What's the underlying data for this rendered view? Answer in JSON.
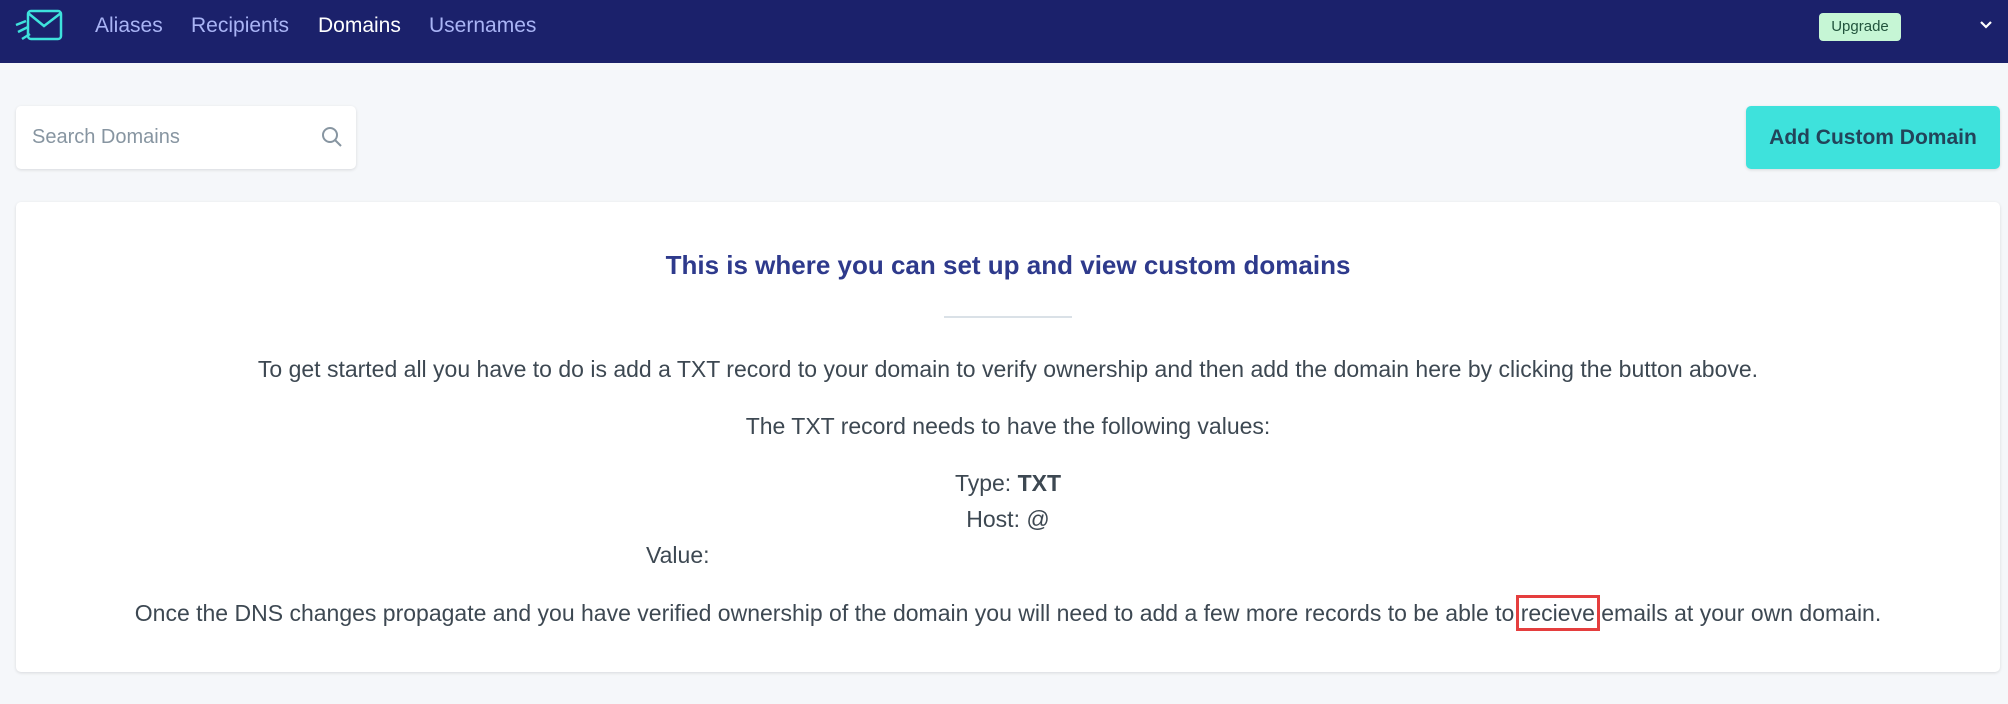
{
  "nav": {
    "links": [
      "Aliases",
      "Recipients",
      "Domains",
      "Usernames"
    ],
    "active": "Domains",
    "upgrade_label": "Upgrade",
    "logo_icon": "envelope-logo-icon",
    "menu_icon": "chevron-down-icon"
  },
  "search": {
    "placeholder": "Search Domains",
    "value": "",
    "icon": "search-icon"
  },
  "actions": {
    "add_label": "Add Custom Domain"
  },
  "info": {
    "title": "This is where you can set up and view custom domains",
    "intro": "To get started all you have to do is add a TXT record to your domain to verify ownership and then add the domain here by clicking the button above.",
    "record_intro": "The TXT record needs to have the following values:",
    "type_label": "Type:",
    "type_value": "TXT",
    "host_label": "Host:",
    "host_value": "@",
    "value_label": "Value:",
    "outro_before": "Once the DNS changes propagate and you have verified ownership of the domain you will need to add a few more records to be able to",
    "outro_highlight": "recieve",
    "outro_after": "emails at your own domain."
  },
  "colors": {
    "navbar": "#1b216b",
    "nav_link": "#a9b4f5",
    "accent_button": "#3ee2dc",
    "title": "#2e3a8c",
    "upgrade_bg": "#c6f6d5",
    "highlight_box": "#e53e3e"
  }
}
